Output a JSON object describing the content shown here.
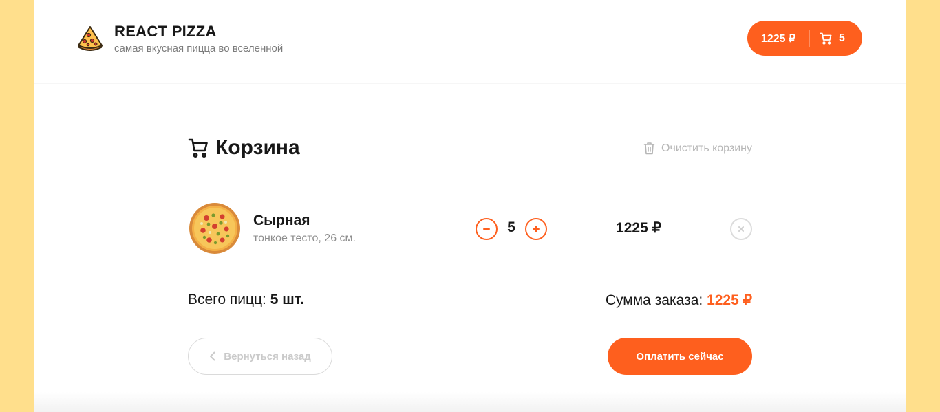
{
  "header": {
    "logo_icon": "pizza-slice-icon",
    "brand_title": "REACT PIZZA",
    "brand_subtitle": "самая вкусная пицца во вселенной",
    "cart_button": {
      "price": "1225 ₽",
      "icon": "cart-icon",
      "count": "5"
    }
  },
  "cart": {
    "title_icon": "cart-icon",
    "title": "Корзина",
    "clear_icon": "trash-icon",
    "clear_label": "Очистить корзину",
    "items": [
      {
        "name": "Сырная",
        "description": "тонкое тесто, 26 см.",
        "quantity": "5",
        "price": "1225 ₽",
        "minus_icon": "minus-icon",
        "plus_icon": "plus-icon",
        "remove_icon": "close-icon"
      }
    ],
    "total_count_label": "Всего пицц:",
    "total_count_value": "5 шт.",
    "total_sum_label": "Сумма заказа:",
    "total_sum_value": "1225 ₽",
    "back_icon": "chevron-left-icon",
    "back_label": "Вернуться назад",
    "pay_label": "Оплатить сейчас"
  },
  "colors": {
    "accent": "#fe5f1e",
    "page_background": "#ffdf8c",
    "text": "#181818",
    "muted": "#b6b6b6"
  }
}
